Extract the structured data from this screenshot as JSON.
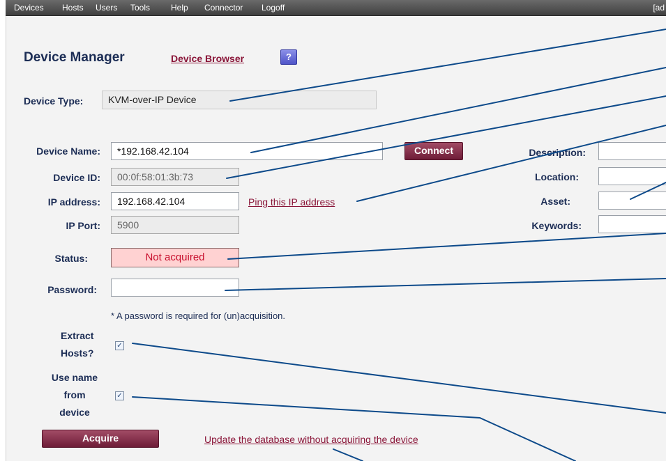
{
  "menu": {
    "items": [
      "Devices",
      "Hosts",
      "Users",
      "Tools",
      "Help",
      "Connector",
      "Logoff"
    ],
    "user_fragment": "[ad"
  },
  "header": {
    "title": "Device Manager",
    "browser_link": "Device Browser",
    "help_label": "?"
  },
  "device_type": {
    "label": "Device Type:",
    "value": "KVM-over-IP Device"
  },
  "form": {
    "device_name": {
      "label": "Device Name:",
      "value": "*192.168.42.104"
    },
    "connect_label": "Connect",
    "device_id": {
      "label": "Device ID:",
      "value": "00:0f:58:01:3b:73"
    },
    "ip_address": {
      "label": "IP address:",
      "value": "192.168.42.104"
    },
    "ping_link": "Ping this IP address",
    "ip_port": {
      "label": "IP Port:",
      "value": "5900"
    },
    "status": {
      "label": "Status:",
      "value": "Not acquired"
    },
    "password": {
      "label": "Password:",
      "value": ""
    },
    "password_note": "* A password is required for (un)acquisition.",
    "extract_hosts": {
      "label_line1": "Extract",
      "label_line2": "Hosts?",
      "checked": true
    },
    "use_name": {
      "label_line1": "Use name",
      "label_line2": "from",
      "label_line3": "device",
      "checked": true
    },
    "acquire_label": "Acquire",
    "update_link": "Update the database without acquiring the device"
  },
  "side": {
    "description": {
      "label": "Description:",
      "value": ""
    },
    "location": {
      "label": "Location:",
      "value": ""
    },
    "asset": {
      "label": "Asset:",
      "value": ""
    },
    "keywords": {
      "label": "Keywords:",
      "value": ""
    }
  },
  "colors": {
    "menubar": "#4f4f4f",
    "accent_link": "#8a1538",
    "button": "#7e2a45",
    "label_text": "#1c2d55",
    "callout_line": "#0d4a8a",
    "status_bg": "#ffd2d2",
    "status_text": "#c8102e"
  }
}
